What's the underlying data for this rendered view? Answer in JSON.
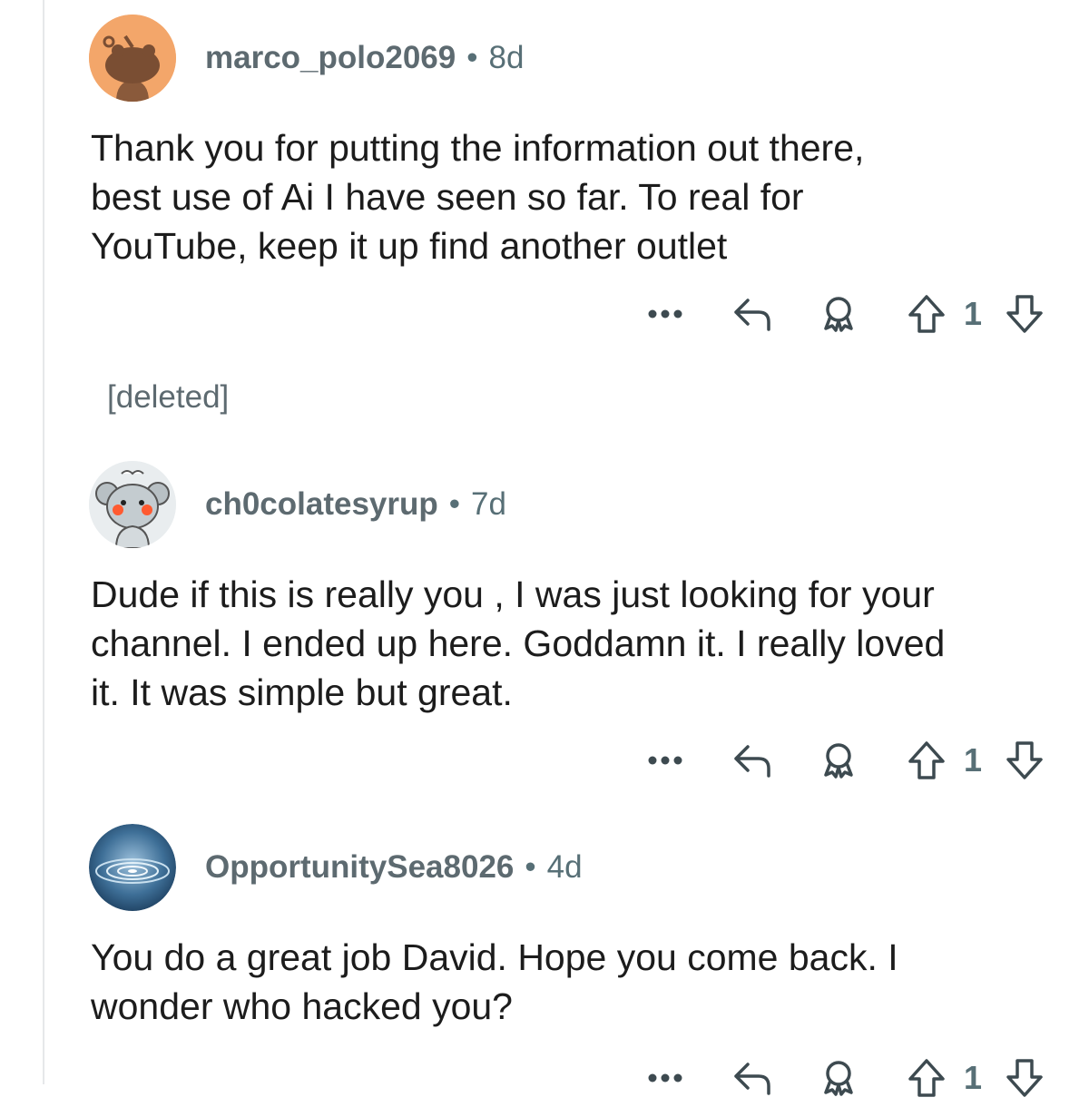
{
  "comments": [
    {
      "username": "marco_polo2069",
      "separator": "•",
      "age": "8d",
      "avatar": "reddit-snoo-orange-avatar",
      "text_lines": [
        "Thank you for putting the information out there,",
        "best use of Ai I have seen so far. To real for",
        "YouTube, keep it up find another outlet"
      ],
      "votes": "1"
    },
    {
      "username": "ch0colatesyrup",
      "separator": "•",
      "age": "7d",
      "avatar": "reddit-snoo-koala-avatar",
      "text_lines": [
        "Dude if this is really you , I was just looking for your",
        "channel. I ended up here. Goddamn it.  I really loved",
        "it. It was simple but great."
      ],
      "votes": "1"
    },
    {
      "username": "OpportunitySea8026",
      "separator": "•",
      "age": "4d",
      "avatar": "water-ripple-avatar",
      "text_lines": [
        "You do a great job David. Hope you come back. I",
        "wonder who hacked you?"
      ],
      "votes": "1"
    }
  ],
  "deleted_label": "[deleted]",
  "icons": {
    "more": "more-icon",
    "reply": "reply-icon",
    "award": "award-icon",
    "upvote": "upvote-arrow-icon",
    "downvote": "downvote-arrow-icon"
  },
  "colors": {
    "meta": "#576f76",
    "icon": "#3d4a50",
    "thread_line": "#e6e8ea"
  }
}
